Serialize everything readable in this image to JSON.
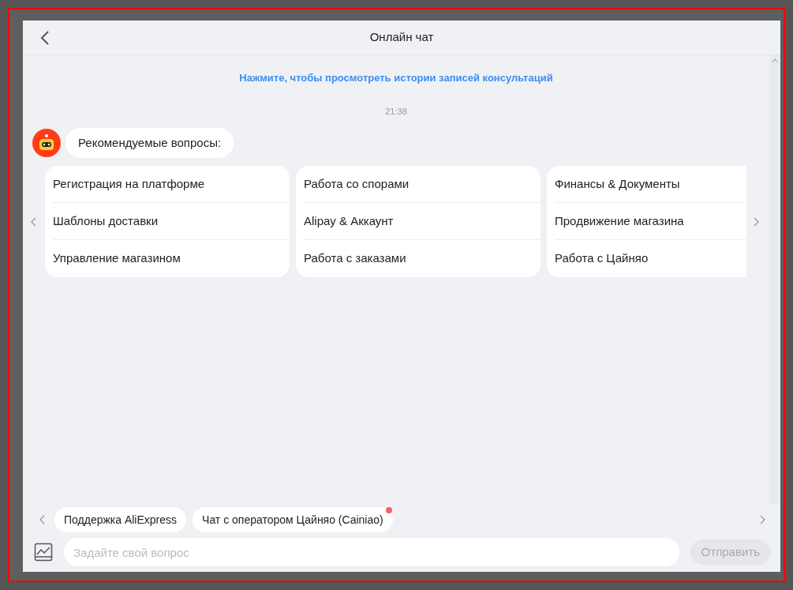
{
  "window": {
    "title": "Онлайн чат"
  },
  "history_link": "Нажмите, чтобы просмотреть истории записей консультаций",
  "timestamp": "21:38",
  "bot_message": "Рекомендуемые вопросы:",
  "question_cards": [
    {
      "items": [
        "Регистрация на платформе",
        "Шаблоны доставки",
        "Управление магазином"
      ]
    },
    {
      "items": [
        "Работа со спорами",
        "Alipay & Аккаунт",
        "Работа с заказами"
      ]
    },
    {
      "items": [
        "Финансы & Документы",
        "Продвижение магазина",
        "Работа с Цайняо"
      ]
    }
  ],
  "quick_chips": [
    {
      "label": "Поддержка AliExpress",
      "unread": false
    },
    {
      "label": "Чат с оператором Цайняо (Cainiao)",
      "unread": true
    }
  ],
  "input": {
    "placeholder": "Задайте свой вопрос"
  },
  "send_button": {
    "label": "Отправить",
    "disabled": true
  }
}
